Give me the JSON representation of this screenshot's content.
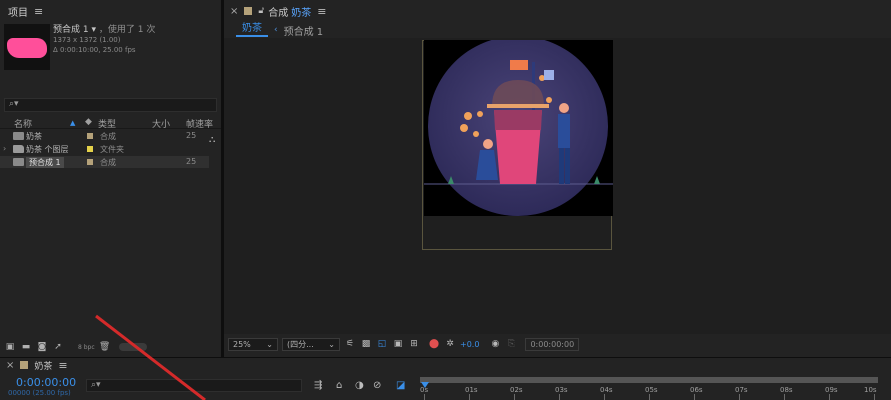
{
  "project_panel": {
    "title": "项目",
    "thumbnail": {
      "color": "#ff4f9a"
    },
    "info": {
      "name": "预合成 1",
      "usage": "，使用了 1 次",
      "dimensions": "1373 x 1372 (1.00)",
      "duration": "Δ 0:00:10:00, 25.00 fps"
    },
    "columns": {
      "name": "名称",
      "type": "类型",
      "size": "大小",
      "frame_rate": "帧速率"
    },
    "items": [
      {
        "name": "奶茶",
        "type": "合成",
        "frame_rate": "25",
        "label_color": "#b5a27a",
        "kind": "comp"
      },
      {
        "name": "奶茶 个图层",
        "type": "文件夹",
        "frame_rate": "",
        "label_color": "#e4d24a",
        "kind": "folder"
      },
      {
        "name": "预合成 1",
        "type": "合成",
        "frame_rate": "25",
        "label_color": "#b5a27a",
        "kind": "comp"
      }
    ],
    "footer": {
      "bpc": "8 bpc"
    }
  },
  "comp_panel": {
    "tab_prefix": "合成",
    "tab_name": "奶茶",
    "tab_swatch": "#b5a27a",
    "breadcrumb": {
      "active": "奶茶",
      "other": "预合成 1"
    },
    "canvas_colors": {
      "circle": "#3b3668",
      "cup": "#e0467a",
      "lid": "#6d4a58"
    },
    "toolbar": {
      "zoom": "25%",
      "resolution": "(四分...",
      "exposure": "+0.0",
      "timecode": "0:00:00:00"
    }
  },
  "timeline_panel": {
    "tab_name": "奶茶",
    "current_time": "0:00:00:00",
    "fps_readout": "00000 (25.00 fps)",
    "ruler": [
      "0s",
      "01s",
      "02s",
      "03s",
      "04s",
      "05s",
      "06s",
      "07s",
      "08s",
      "09s",
      "10s"
    ]
  },
  "accent": "#3a8fe8"
}
